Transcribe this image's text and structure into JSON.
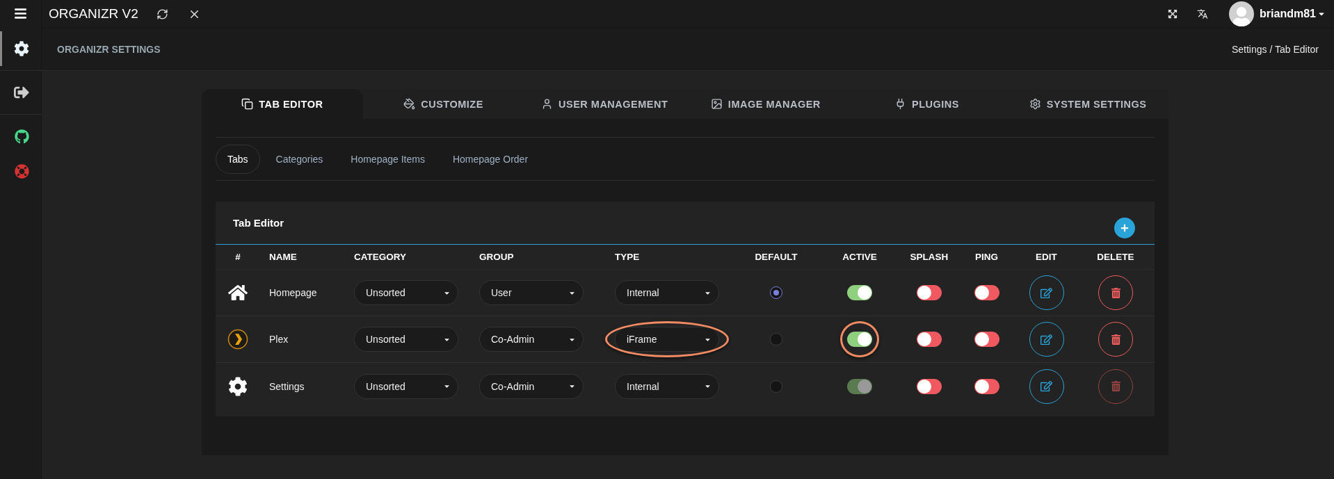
{
  "topbar": {
    "title": "ORGANIZR V2",
    "user": "briandm81"
  },
  "sidebar": {
    "items": [
      {
        "kind": "settings",
        "selected": true
      },
      {
        "kind": "logout",
        "selected": false
      },
      {
        "kind": "github",
        "selected": false
      },
      {
        "kind": "help",
        "selected": false
      }
    ]
  },
  "page_header": {
    "title": "ORGANIZR SETTINGS",
    "breadcrumb": "Settings / Tab Editor"
  },
  "main_tabs": [
    {
      "kind": "tabs",
      "label": "TAB EDITOR",
      "selected": true
    },
    {
      "kind": "customize",
      "label": "CUSTOMIZE",
      "selected": false
    },
    {
      "kind": "users",
      "label": "USER MANAGEMENT",
      "selected": false
    },
    {
      "kind": "images",
      "label": "IMAGE MANAGER",
      "selected": false
    },
    {
      "kind": "plugins",
      "label": "PLUGINS",
      "selected": false
    },
    {
      "kind": "system",
      "label": "SYSTEM SETTINGS",
      "selected": false
    }
  ],
  "sub_tabs": [
    {
      "label": "Tabs",
      "selected": true
    },
    {
      "label": "Categories",
      "selected": false
    },
    {
      "label": "Homepage Items",
      "selected": false
    },
    {
      "label": "Homepage Order",
      "selected": false
    }
  ],
  "table": {
    "title": "Tab Editor",
    "columns": [
      "#",
      "NAME",
      "CATEGORY",
      "GROUP",
      "TYPE",
      "DEFAULT",
      "ACTIVE",
      "SPLASH",
      "PING",
      "EDIT",
      "DELETE"
    ],
    "rows": [
      {
        "kind": "home",
        "name": "Homepage",
        "category": "Unsorted",
        "group": "User",
        "type": "Internal",
        "type_highlighted": false,
        "default": true,
        "active": {
          "on": true,
          "disabled": false,
          "highlighted": false
        },
        "splash": false,
        "ping": false,
        "delete_disabled": false
      },
      {
        "kind": "plex",
        "name": "Plex",
        "category": "Unsorted",
        "group": "Co-Admin",
        "type": "iFrame",
        "type_highlighted": true,
        "default": false,
        "active": {
          "on": true,
          "disabled": false,
          "highlighted": true
        },
        "splash": false,
        "ping": false,
        "delete_disabled": false
      },
      {
        "kind": "settings",
        "name": "Settings",
        "category": "Unsorted",
        "group": "Co-Admin",
        "type": "Internal",
        "type_highlighted": false,
        "default": false,
        "active": {
          "on": true,
          "disabled": true,
          "highlighted": false
        },
        "splash": false,
        "ping": false,
        "delete_disabled": true
      }
    ]
  }
}
